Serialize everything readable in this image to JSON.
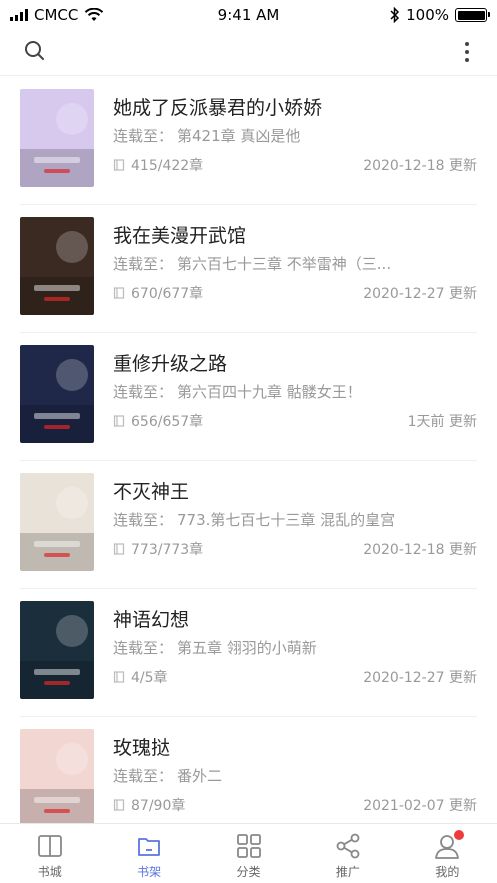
{
  "status_bar": {
    "carrier": "CMCC",
    "time": "9:41 AM",
    "battery": "100%",
    "battery_level": 1.0
  },
  "nav": {
    "search_icon": "search-icon",
    "more_icon": "more-vertical-icon"
  },
  "books": [
    {
      "title": "她成了反派暴君的小娇娇",
      "latest_prefix": "连载至：",
      "latest": "第421章 真凶是他",
      "progress": "415/422章",
      "updated": "2020-12-18 更新",
      "cover_color": "#d7c8ee"
    },
    {
      "title": "我在美漫开武馆",
      "latest_prefix": "连载至：",
      "latest": "第六百七十三章 不举雷神（三...",
      "progress": "670/677章",
      "updated": "2020-12-27 更新",
      "cover_color": "#3a2a22"
    },
    {
      "title": "重修升级之路",
      "latest_prefix": "连载至：",
      "latest": "第六百四十九章 骷髅女王！",
      "progress": "656/657章",
      "updated": "1天前 更新",
      "cover_color": "#1f2848"
    },
    {
      "title": "不灭神王",
      "latest_prefix": "连载至：",
      "latest": "773.第七百七十三章  混乱的皇宫",
      "progress": "773/773章",
      "updated": "2020-12-18 更新",
      "cover_color": "#e9e2d8"
    },
    {
      "title": "神语幻想",
      "latest_prefix": "连载至：",
      "latest": "第五章 翎羽的小萌新",
      "progress": "4/5章",
      "updated": "2020-12-27 更新",
      "cover_color": "#1a2e3c"
    },
    {
      "title": "玫瑰挞",
      "latest_prefix": "连载至：",
      "latest": "番外二",
      "progress": "87/90章",
      "updated": "2021-02-07 更新",
      "cover_color": "#f2d6d2"
    }
  ],
  "tabs": [
    {
      "label": "书城",
      "icon": "book-open-icon",
      "active": false
    },
    {
      "label": "书架",
      "icon": "bookshelf-icon",
      "active": true
    },
    {
      "label": "分类",
      "icon": "grid-icon",
      "active": false
    },
    {
      "label": "推广",
      "icon": "share-icon",
      "active": false
    },
    {
      "label": "我的",
      "icon": "user-icon",
      "active": false,
      "badge": true
    }
  ],
  "colors": {
    "accent": "#5b74e0",
    "badge": "#ee3c3c",
    "text_secondary": "#999999"
  }
}
